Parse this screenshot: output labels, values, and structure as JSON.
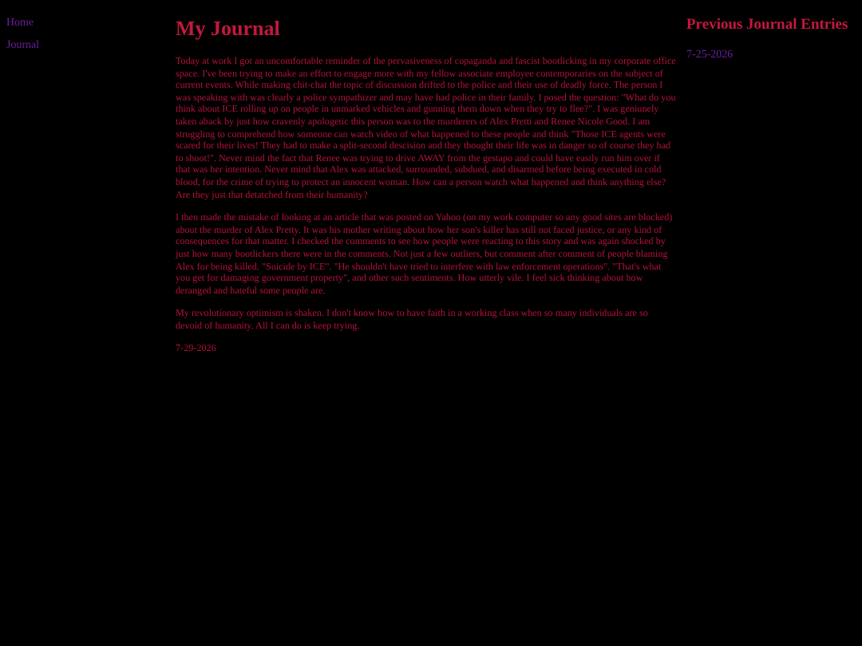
{
  "nav": {
    "links": [
      "Home",
      "Journal"
    ]
  },
  "main": {
    "title": "My Journal",
    "paragraphs": [
      "Today at work I got an uncomfortable reminder of the pervasiveness of copaganda and fascist bootlicking in my corporate office space. I've been trying to make an effort to engage more with my fellow associate employee contemporaries on the subject of current events. While making chit-chat the topic of discussion drifted to the police and their use of deadly force. The person I was speaking with was clearly a police sympathizer and may have had police in their family. I posed the question: \"What do you think about ICE rolling up on people in unmarked vehicles and gunning them down when they try to flee?\". I was geniunely taken aback by just how cravenly apologetic this person was to the murderers of Alex Pretti and Renee Nicole Good. I am struggling to comprehend how someone can watch video of what happened to these people and think \"Those ICE agents were scared for their lives! They had to make a split-second descision and they thought their life was in danger so of course they had to shoot!\". Never mind the fact that Renee was trying to drive AWAY from the gestapo and could have easily run him over if that was her intention. Never mind that Alex was attacked, surrounded, subdued, and disarmed before being executed in cold blood, for the crime of trying to protect an innocent woman. How can a person watch what happened and think anything else? Are they just that detatched from their humanity?",
      "I then made the mistake of looking at an article that was posted on Yahoo (on my work computer so any good sites are blocked) about the murder of Alex Pretty. It was his mother writing about how her son's killer has still not faced justice, or any kind of consequences for that matter. I checked the comments to see how people were reacting to this story and was again shocked by just how many bootlickers there were in the comments. Not just a few outliers, but comment after comment of people blaming Alex for being killed. \"Suicide by ICE\". \"He shouldn't have tried to interfere with law enforcement operations\". \"That's what you get for damaging government property\", and other such sentiments. How utterly vile. I feel sick thinking about how deranged and hateful some people are.",
      "My revolutionary optimism is shaken. I don't know how to have faith in a working class when so many individuals are so devoid of humanity. All I can do is keep trying."
    ],
    "date": "7-29-2026"
  },
  "aside": {
    "title": "Previous Journal Entries",
    "entries": [
      "7-25-2026"
    ]
  }
}
